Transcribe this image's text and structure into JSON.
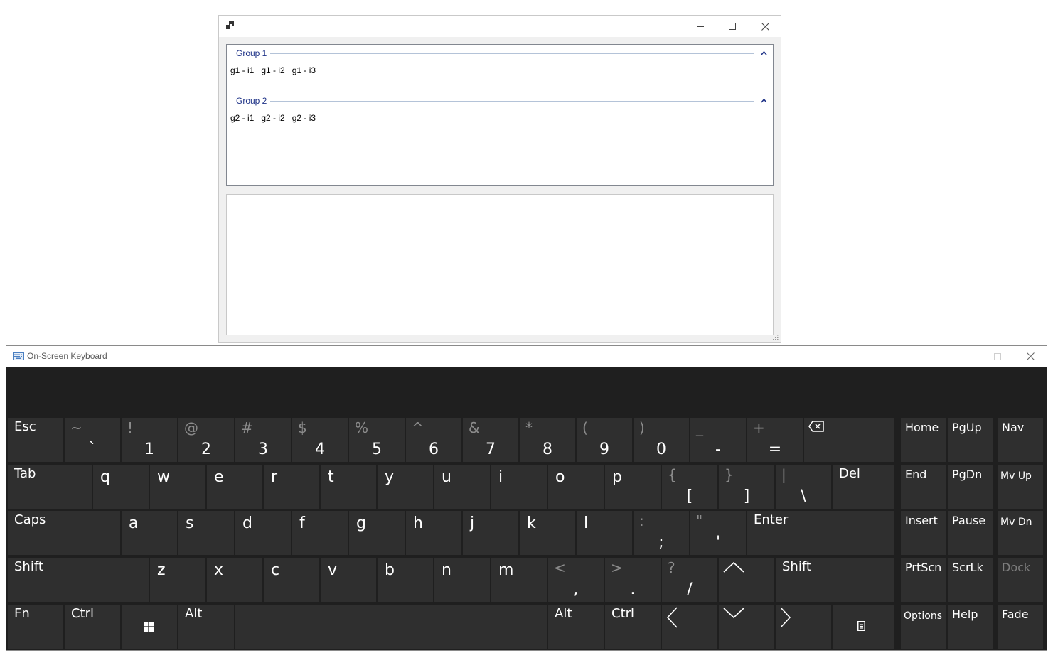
{
  "app_window": {
    "title": "",
    "group1": {
      "header": "Group 1",
      "items": [
        "g1 - i1",
        "g1 - i2",
        "g1 - i3"
      ]
    },
    "group2": {
      "header": "Group 2",
      "items": [
        "g2 - i1",
        "g2 - i2",
        "g2 - i3"
      ]
    }
  },
  "osk": {
    "title": "On-Screen Keyboard",
    "row1": [
      {
        "label": "Esc"
      },
      {
        "top": "~",
        "main": "`"
      },
      {
        "top": "!",
        "main": "1"
      },
      {
        "top": "@",
        "main": "2"
      },
      {
        "top": "#",
        "main": "3"
      },
      {
        "top": "$",
        "main": "4"
      },
      {
        "top": "%",
        "main": "5"
      },
      {
        "top": "^",
        "main": "6"
      },
      {
        "top": "&",
        "main": "7"
      },
      {
        "top": "*",
        "main": "8"
      },
      {
        "top": "(",
        "main": "9"
      },
      {
        "top": ")",
        "main": "0"
      },
      {
        "top": "_",
        "main": "-"
      },
      {
        "top": "+",
        "main": "="
      },
      {
        "icon": "backspace-icon"
      }
    ],
    "row2": [
      {
        "label": "Tab"
      },
      {
        "main": "q"
      },
      {
        "main": "w"
      },
      {
        "main": "e"
      },
      {
        "main": "r"
      },
      {
        "main": "t"
      },
      {
        "main": "y"
      },
      {
        "main": "u"
      },
      {
        "main": "i"
      },
      {
        "main": "o"
      },
      {
        "main": "p"
      },
      {
        "top": "{",
        "main": "["
      },
      {
        "top": "}",
        "main": "]"
      },
      {
        "top": "|",
        "main": "\\"
      },
      {
        "label": "Del"
      }
    ],
    "row3": [
      {
        "label": "Caps"
      },
      {
        "main": "a"
      },
      {
        "main": "s"
      },
      {
        "main": "d"
      },
      {
        "main": "f"
      },
      {
        "main": "g"
      },
      {
        "main": "h"
      },
      {
        "main": "j"
      },
      {
        "main": "k"
      },
      {
        "main": "l"
      },
      {
        "top": ":",
        "main": ";"
      },
      {
        "top": "\"",
        "main": "'"
      },
      {
        "label": "Enter"
      }
    ],
    "row4": [
      {
        "label": "Shift"
      },
      {
        "main": "z"
      },
      {
        "main": "x"
      },
      {
        "main": "c"
      },
      {
        "main": "v"
      },
      {
        "main": "b"
      },
      {
        "main": "n"
      },
      {
        "main": "m"
      },
      {
        "top": "<",
        "main": ","
      },
      {
        "top": ">",
        "main": "."
      },
      {
        "top": "?",
        "main": "/"
      },
      {
        "icon": "arrow-up-icon"
      },
      {
        "label": "Shift"
      }
    ],
    "row5": [
      {
        "label": "Fn"
      },
      {
        "label": "Ctrl"
      },
      {
        "icon": "windows-logo-icon"
      },
      {
        "label": "Alt"
      },
      {
        "label": ""
      },
      {
        "label": "Alt"
      },
      {
        "label": "Ctrl"
      },
      {
        "icon": "arrow-left-icon"
      },
      {
        "icon": "arrow-down-icon"
      },
      {
        "icon": "arrow-right-icon"
      },
      {
        "icon": "context-menu-icon"
      }
    ],
    "nav_keys": [
      {
        "label": "Home"
      },
      {
        "label": "PgUp"
      },
      {
        "label": "Nav"
      },
      {
        "label": "End"
      },
      {
        "label": "PgDn"
      },
      {
        "label": "Mv Up"
      },
      {
        "label": "Insert"
      },
      {
        "label": "Pause"
      },
      {
        "label": "Mv Dn"
      },
      {
        "label": "PrtScn"
      },
      {
        "label": "ScrLk"
      },
      {
        "label": "Dock",
        "disabled": true
      },
      {
        "label": "Options"
      },
      {
        "label": "Help"
      },
      {
        "label": "Fade"
      }
    ]
  }
}
